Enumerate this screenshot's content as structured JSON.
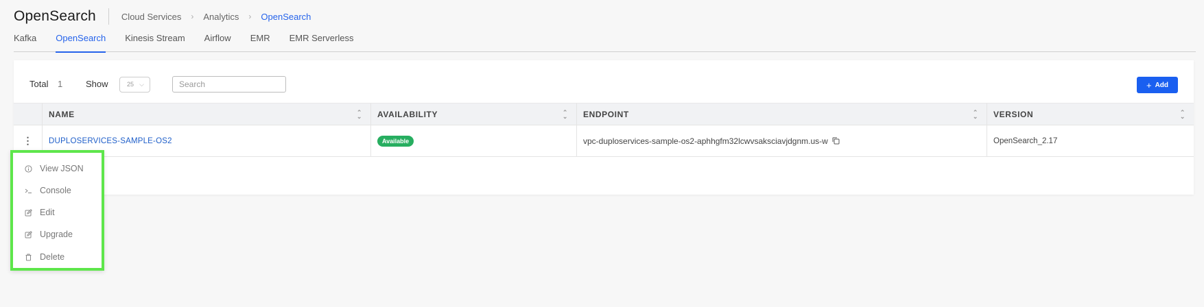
{
  "page": {
    "title": "OpenSearch",
    "breadcrumb": [
      "Cloud Services",
      "Analytics",
      "OpenSearch"
    ]
  },
  "tabs": [
    {
      "label": "Kafka",
      "active": false
    },
    {
      "label": "OpenSearch",
      "active": true
    },
    {
      "label": "Kinesis Stream",
      "active": false
    },
    {
      "label": "Airflow",
      "active": false
    },
    {
      "label": "EMR",
      "active": false
    },
    {
      "label": "EMR Serverless",
      "active": false
    }
  ],
  "toolbar": {
    "total_label": "Total",
    "total_count": "1",
    "show_label": "Show",
    "show_value": "25",
    "search_placeholder": "Search",
    "add_label": "Add"
  },
  "table": {
    "columns": [
      "NAME",
      "AVAILABILITY",
      "ENDPOINT",
      "VERSION"
    ],
    "rows": [
      {
        "name": "DUPLOSERVICES-SAMPLE-OS2",
        "availability": "Available",
        "endpoint": "vpc-duploservices-sample-os2-aphhgfm32lcwvsaksciavjdgnm.us-w",
        "version": "OpenSearch_2.17"
      }
    ]
  },
  "row_menu": [
    {
      "label": "View JSON",
      "icon": "info-circle-icon"
    },
    {
      "label": "Console",
      "icon": "terminal-icon"
    },
    {
      "label": "Edit",
      "icon": "edit-icon"
    },
    {
      "label": "Upgrade",
      "icon": "upgrade-edit-icon"
    },
    {
      "label": "Delete",
      "icon": "trash-icon"
    }
  ],
  "colors": {
    "accent": "#2563eb",
    "add_button": "#1a5ff0",
    "badge_available": "#27ae60",
    "menu_highlight": "#5ee64b"
  }
}
